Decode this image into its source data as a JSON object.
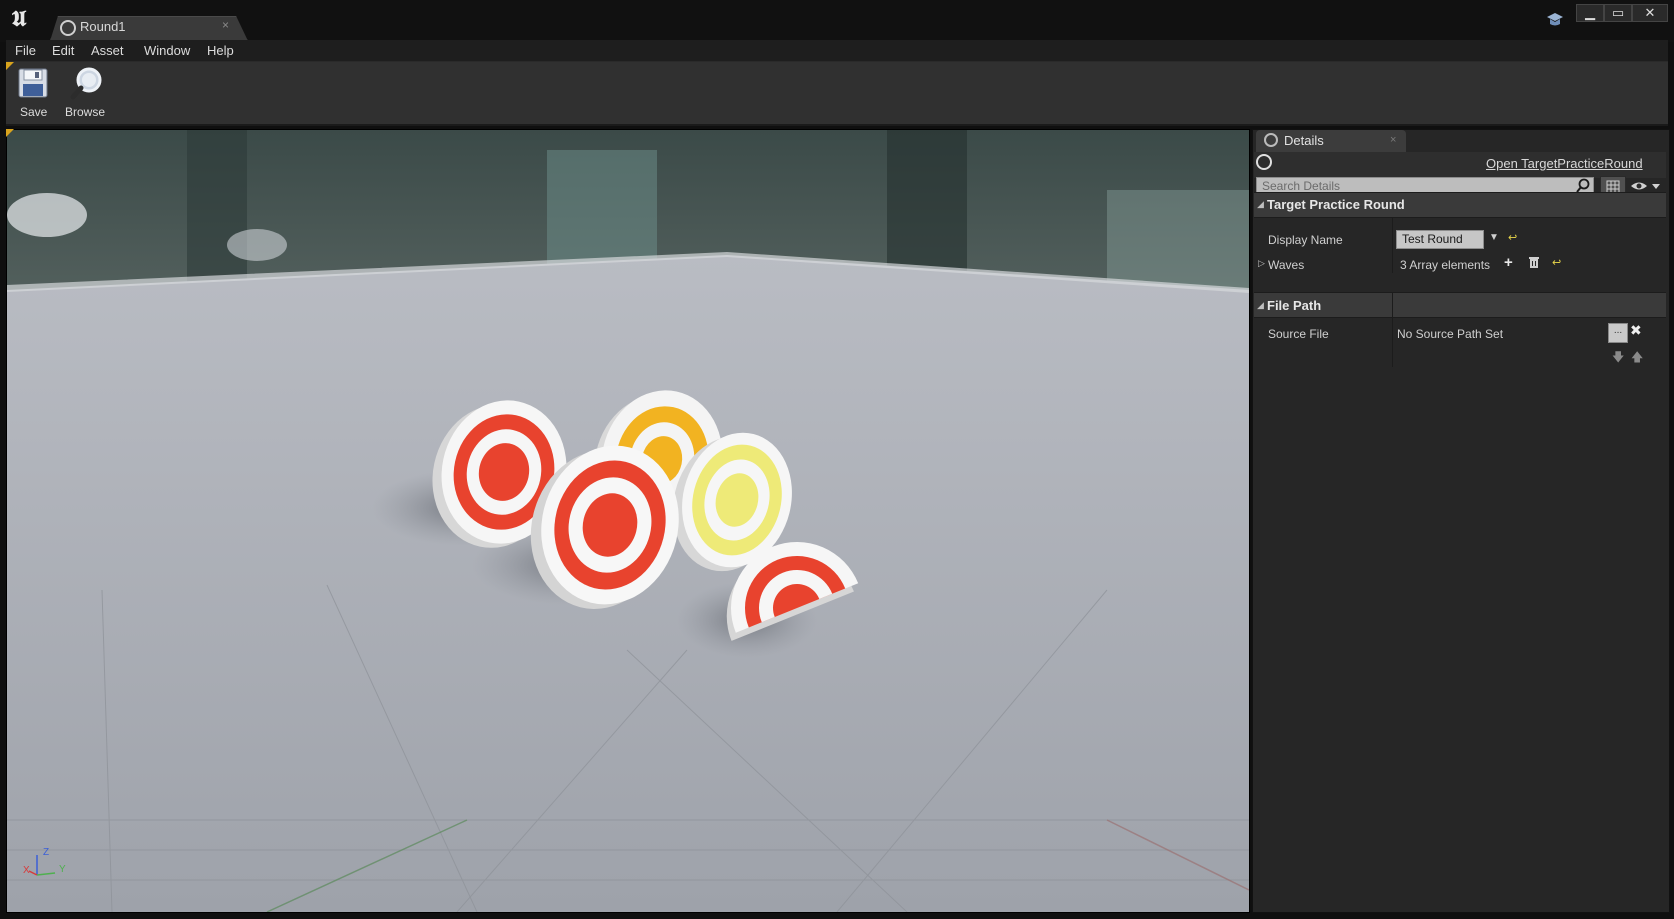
{
  "window": {
    "tab_title": "Round1",
    "tab_close": "×",
    "controls": {
      "minimize": "▁",
      "maximize": "▭",
      "close": "✕"
    }
  },
  "menu": {
    "items": [
      "File",
      "Edit",
      "Asset",
      "Window",
      "Help"
    ]
  },
  "toolbar": {
    "save_label": "Save",
    "browse_label": "Browse"
  },
  "viewport": {
    "axis_labels": {
      "x": "X",
      "y": "Y",
      "z": "Z"
    }
  },
  "details": {
    "tab_label": "Details",
    "tab_close": "×",
    "open_link": "Open TargetPracticeRound",
    "search_placeholder": "Search Details",
    "categories": {
      "target_practice_round": {
        "label": "Target Practice Round",
        "display_name_label": "Display Name",
        "display_name_value": "Test Round",
        "waves_label": "Waves",
        "waves_value": "3 Array elements"
      },
      "file_path": {
        "label": "File Path",
        "source_file_label": "Source File",
        "source_file_value": "No Source Path Set",
        "browse_button": "...",
        "clear_button": "✖"
      }
    }
  },
  "icons": {
    "app_logo": "unreal-logo-icon",
    "learn": "learn-icon",
    "save": "save-icon",
    "browse": "magnifier-icon",
    "search": "search-icon",
    "eye": "eye-icon",
    "add": "plus-icon",
    "delete": "trash-icon",
    "reset": "reset-to-default-icon"
  },
  "colors": {
    "accent_gold": "#d9a41d",
    "target_red": "#e8432e",
    "target_orange": "#f2b321",
    "target_yellow": "#eeea78",
    "reset_yellow": "#e6d44a"
  }
}
